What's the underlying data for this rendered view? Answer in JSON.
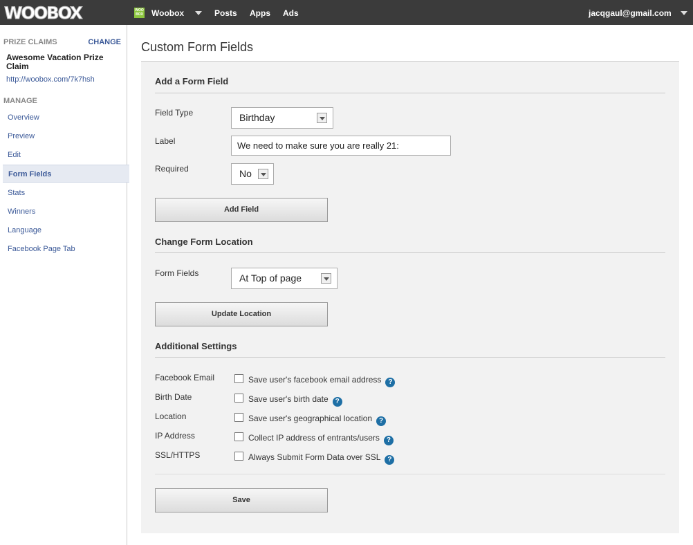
{
  "topbar": {
    "logo": "WOOBOX",
    "brand_mini": "WOO BOX",
    "brand_name": "Woobox",
    "nav": [
      "Posts",
      "Apps",
      "Ads"
    ],
    "user_email": "jacqgaul@gmail.com"
  },
  "sidebar": {
    "section_prize": "PRIZE CLAIMS",
    "change_link": "CHANGE",
    "campaign_name": "Awesome Vacation Prize Claim",
    "campaign_url": "http://woobox.com/7k7hsh",
    "section_manage": "MANAGE",
    "items": [
      {
        "label": "Overview"
      },
      {
        "label": "Preview"
      },
      {
        "label": "Edit"
      },
      {
        "label": "Form Fields",
        "active": true
      },
      {
        "label": "Stats"
      },
      {
        "label": "Winners"
      },
      {
        "label": "Language"
      },
      {
        "label": "Facebook Page Tab"
      }
    ]
  },
  "main": {
    "title": "Custom Form Fields",
    "add_section": {
      "title": "Add a Form Field",
      "field_type_label": "Field Type",
      "field_type_value": "Birthday",
      "label_label": "Label",
      "label_value": "We need to make sure you are really 21:",
      "required_label": "Required",
      "required_value": "No",
      "add_button": "Add Field"
    },
    "location_section": {
      "title": "Change Form Location",
      "form_fields_label": "Form Fields",
      "form_fields_value": "At Top of page",
      "update_button": "Update Location"
    },
    "additional_section": {
      "title": "Additional Settings",
      "settings": [
        {
          "label": "Facebook Email",
          "text": "Save user's facebook email address",
          "checked": false
        },
        {
          "label": "Birth Date",
          "text": "Save user's birth date",
          "checked": false
        },
        {
          "label": "Location",
          "text": "Save user's geographical location",
          "checked": false
        },
        {
          "label": "IP Address",
          "text": "Collect IP address of entrants/users",
          "checked": false
        },
        {
          "label": "SSL/HTTPS",
          "text": "Always Submit Form Data over SSL",
          "checked": false
        }
      ],
      "help_glyph": "?"
    },
    "save_button": "Save"
  },
  "colors": {
    "topbar_bg": "#3b3b3b",
    "link_blue": "#3b5998",
    "help_blue": "#1e6fa5",
    "brand_green": "#8dc63f"
  }
}
